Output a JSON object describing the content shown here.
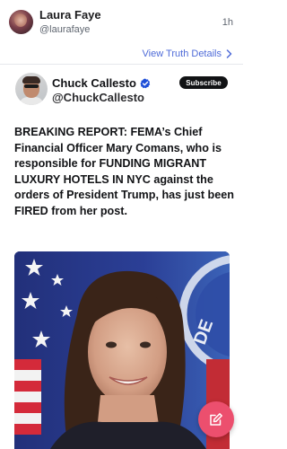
{
  "post": {
    "author_name": "Laura Faye",
    "author_handle": "@laurafaye",
    "time": "1h",
    "view_details_label": "View Truth Details"
  },
  "quoted": {
    "author_name": "Chuck Callesto",
    "author_handle": "@ChuckCallesto",
    "subscribe_label": "Subscribe",
    "text": "BREAKING REPORT:  FEMA’s Chief Financial Officer Mary Comans, who is responsible for FUNDING MIGRANT LUXURY HOTELS IN NYC against the orders of President Trump, has just been FIRED from her post."
  },
  "icons": {
    "chevron": "chevron-right-icon",
    "verified": "verified-check-icon",
    "compose": "pencil-compose-icon"
  },
  "colors": {
    "link": "#4f6bd8",
    "verified": "#1d4ed8",
    "compose_button": "#ec4f6e",
    "subscribe_bg": "#111214"
  }
}
